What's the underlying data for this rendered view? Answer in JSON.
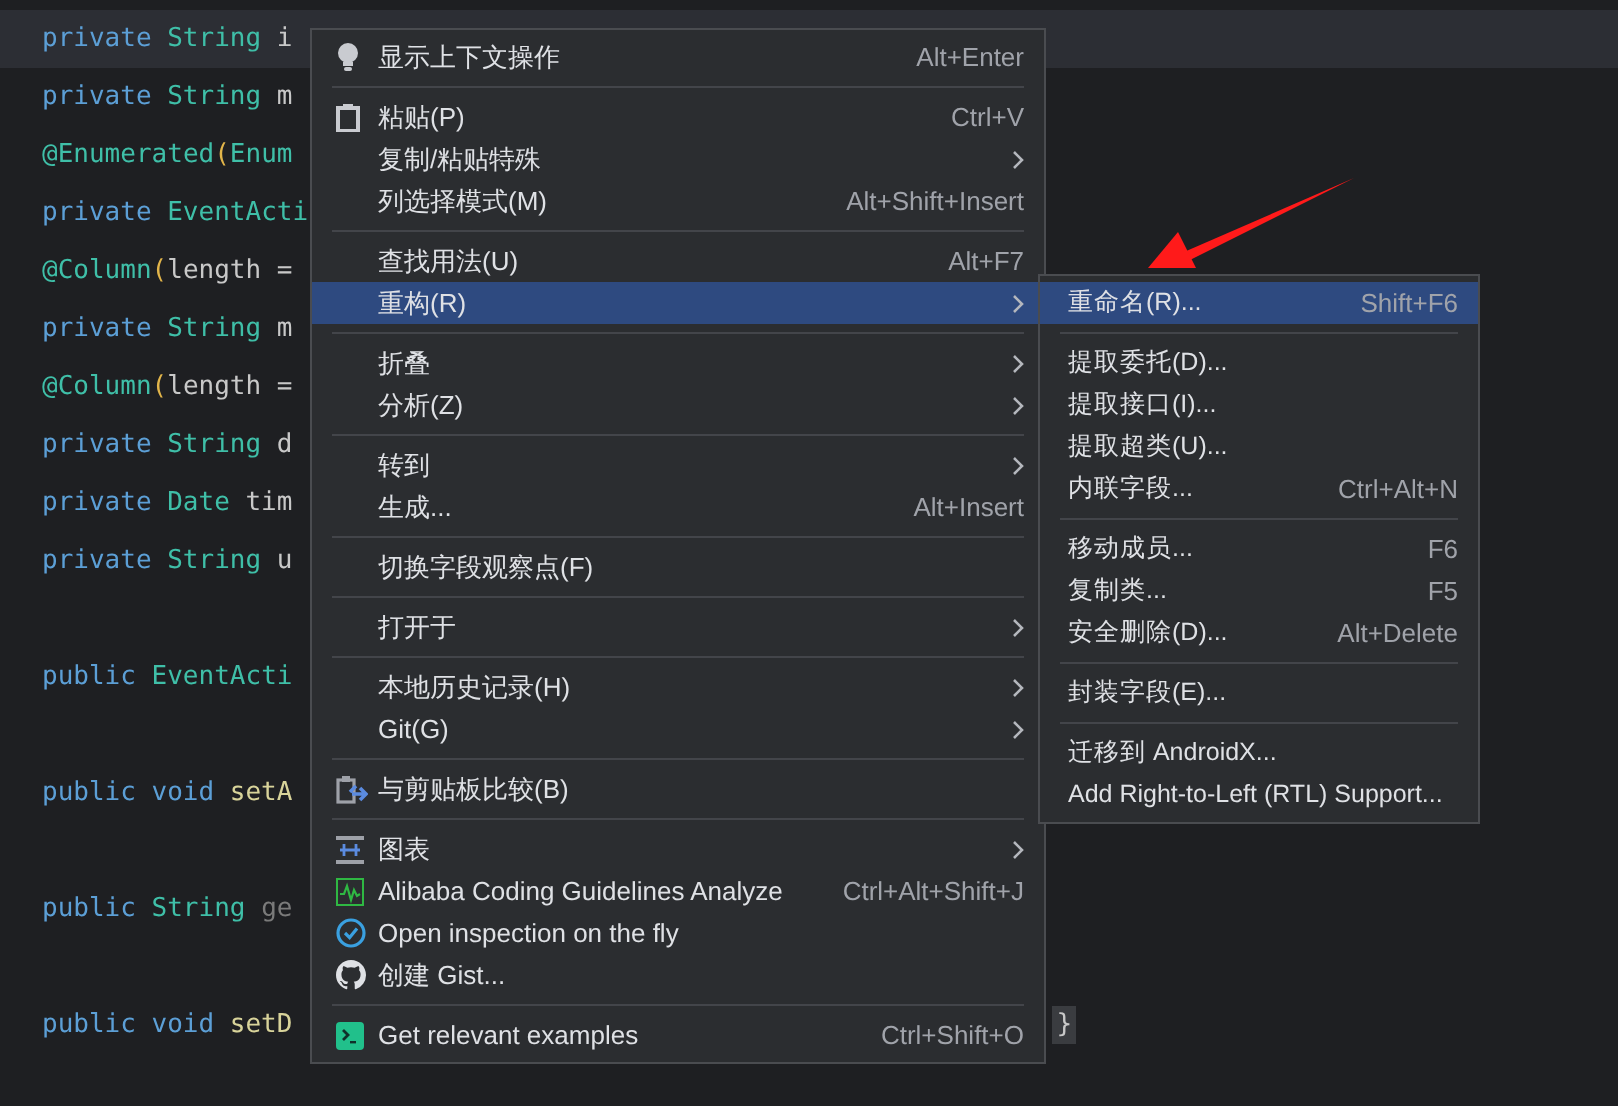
{
  "editor": {
    "lines": [
      {
        "tokens": [
          {
            "kind": "keyword",
            "text": "private"
          },
          {
            "kind": "type",
            "text": "String"
          },
          {
            "kind": "plain",
            "text": "i"
          }
        ],
        "current": true,
        "blank_before": false
      },
      {
        "tokens": [
          {
            "kind": "keyword",
            "text": "private"
          },
          {
            "kind": "type",
            "text": "String"
          },
          {
            "kind": "plain",
            "text": "m"
          }
        ],
        "current": false,
        "blank_before": false
      },
      {
        "tokens": [
          {
            "kind": "annotation",
            "text": "@Enumerated"
          },
          {
            "kind": "paren",
            "text": "("
          },
          {
            "kind": "type",
            "text": "Enum"
          }
        ],
        "current": false,
        "blank_before": false
      },
      {
        "tokens": [
          {
            "kind": "keyword",
            "text": "private"
          },
          {
            "kind": "type",
            "text": "EventActi"
          }
        ],
        "current": false,
        "blank_before": false
      },
      {
        "tokens": [
          {
            "kind": "annotation",
            "text": "@Column"
          },
          {
            "kind": "paren",
            "text": "("
          },
          {
            "kind": "plain",
            "text": "length ="
          }
        ],
        "current": false,
        "blank_before": false
      },
      {
        "tokens": [
          {
            "kind": "keyword",
            "text": "private"
          },
          {
            "kind": "type",
            "text": "String"
          },
          {
            "kind": "plain",
            "text": "m"
          }
        ],
        "current": false,
        "blank_before": false
      },
      {
        "tokens": [
          {
            "kind": "annotation",
            "text": "@Column"
          },
          {
            "kind": "paren",
            "text": "("
          },
          {
            "kind": "plain",
            "text": "length ="
          }
        ],
        "current": false,
        "blank_before": false
      },
      {
        "tokens": [
          {
            "kind": "keyword",
            "text": "private"
          },
          {
            "kind": "type",
            "text": "String"
          },
          {
            "kind": "plain",
            "text": "d"
          }
        ],
        "current": false,
        "blank_before": false
      },
      {
        "tokens": [
          {
            "kind": "keyword",
            "text": "private"
          },
          {
            "kind": "type",
            "text": "Date"
          },
          {
            "kind": "plain",
            "text": "tim"
          }
        ],
        "current": false,
        "blank_before": false
      },
      {
        "tokens": [
          {
            "kind": "keyword",
            "text": "private"
          },
          {
            "kind": "type",
            "text": "String"
          },
          {
            "kind": "plain",
            "text": "u"
          }
        ],
        "current": false,
        "blank_before": false
      },
      {
        "tokens": [
          {
            "kind": "keyword",
            "text": "public"
          },
          {
            "kind": "type",
            "text": "EventActi"
          }
        ],
        "current": false,
        "blank_before": true
      },
      {
        "tokens": [
          {
            "kind": "keyword",
            "text": "public"
          },
          {
            "kind": "keyword",
            "text": "void"
          },
          {
            "kind": "method",
            "text": "setA"
          }
        ],
        "current": false,
        "blank_before": true
      },
      {
        "tokens": [
          {
            "kind": "keyword",
            "text": "public"
          },
          {
            "kind": "type",
            "text": "String"
          },
          {
            "kind": "dim",
            "text": "ge"
          }
        ],
        "current": false,
        "blank_before": true
      },
      {
        "tokens": [
          {
            "kind": "keyword",
            "text": "public"
          },
          {
            "kind": "keyword",
            "text": "void"
          },
          {
            "kind": "method",
            "text": "setD"
          }
        ],
        "current": false,
        "blank_before": true,
        "trailing": "}"
      }
    ]
  },
  "context_menu": {
    "groups": [
      [
        {
          "kind": "bulb",
          "label": "显示上下文操作",
          "shortcut": "Alt+Enter",
          "submenu": false,
          "selected": false
        }
      ],
      [
        {
          "kind": "clipboard",
          "label": "粘贴(P)",
          "shortcut": "Ctrl+V",
          "submenu": false,
          "selected": false
        },
        {
          "kind": "plain",
          "label": "复制/粘贴特殊",
          "submenu": true,
          "selected": false
        },
        {
          "kind": "plain",
          "label": "列选择模式(M)",
          "shortcut": "Alt+Shift+Insert",
          "submenu": false,
          "selected": false
        }
      ],
      [
        {
          "kind": "plain",
          "label": "查找用法(U)",
          "shortcut": "Alt+F7",
          "submenu": false,
          "selected": false
        },
        {
          "kind": "plain",
          "label": "重构(R)",
          "submenu": true,
          "selected": true
        }
      ],
      [
        {
          "kind": "plain",
          "label": "折叠",
          "submenu": true,
          "selected": false
        },
        {
          "kind": "plain",
          "label": "分析(Z)",
          "submenu": true,
          "selected": false
        }
      ],
      [
        {
          "kind": "plain",
          "label": "转到",
          "submenu": true,
          "selected": false
        },
        {
          "kind": "plain",
          "label": "生成...",
          "shortcut": "Alt+Insert",
          "submenu": false,
          "selected": false
        }
      ],
      [
        {
          "kind": "plain",
          "label": "切换字段观察点(F)",
          "submenu": false,
          "selected": false
        }
      ],
      [
        {
          "kind": "plain",
          "label": "打开于",
          "submenu": true,
          "selected": false
        }
      ],
      [
        {
          "kind": "plain",
          "label": "本地历史记录(H)",
          "submenu": true,
          "selected": false
        },
        {
          "kind": "plain",
          "label": "Git(G)",
          "submenu": true,
          "selected": false
        }
      ],
      [
        {
          "kind": "compare",
          "label": "与剪贴板比较(B)",
          "submenu": false,
          "selected": false
        }
      ],
      [
        {
          "kind": "diagram",
          "label": "图表",
          "submenu": true,
          "selected": false
        },
        {
          "kind": "pulse",
          "label": "Alibaba Coding Guidelines Analyze",
          "shortcut": "Ctrl+Alt+Shift+J",
          "submenu": false,
          "selected": false
        },
        {
          "kind": "check",
          "label": "Open inspection on the fly",
          "submenu": false,
          "selected": false
        },
        {
          "kind": "github",
          "label": "创建 Gist...",
          "submenu": false,
          "selected": false
        }
      ],
      [
        {
          "kind": "terminal",
          "label": "Get relevant examples",
          "shortcut": "Ctrl+Shift+O",
          "submenu": false,
          "selected": false
        }
      ]
    ]
  },
  "submenu": {
    "groups": [
      [
        {
          "label": "重命名(R)...",
          "shortcut": "Shift+F6",
          "selected": true
        }
      ],
      [
        {
          "label": "提取委托(D)...",
          "selected": false
        },
        {
          "label": "提取接口(I)...",
          "selected": false
        },
        {
          "label": "提取超类(U)...",
          "selected": false
        },
        {
          "label": "内联字段...",
          "shortcut": "Ctrl+Alt+N",
          "selected": false
        }
      ],
      [
        {
          "label": "移动成员...",
          "shortcut": "F6",
          "selected": false
        },
        {
          "label": "复制类...",
          "shortcut": "F5",
          "selected": false
        },
        {
          "label": "安全删除(D)...",
          "shortcut": "Alt+Delete",
          "selected": false
        }
      ],
      [
        {
          "label": "封装字段(E)...",
          "selected": false
        }
      ],
      [
        {
          "label": "迁移到 AndroidX...",
          "selected": false
        },
        {
          "label": "Add Right-to-Left (RTL) Support...",
          "selected": false
        }
      ]
    ]
  }
}
